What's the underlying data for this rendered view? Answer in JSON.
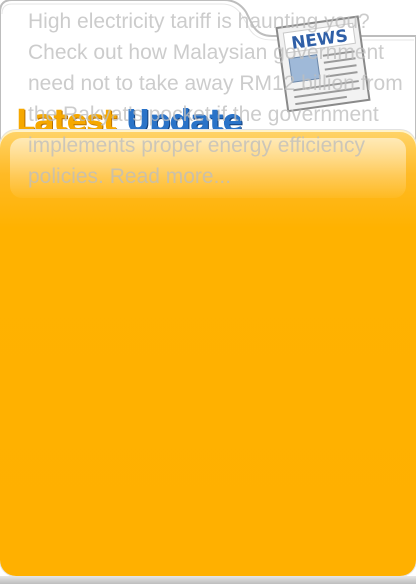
{
  "widget": {
    "headline_word1": "Latest",
    "headline_word2": "Update",
    "news_icon_label": "NEWS"
  },
  "article": {
    "text": "High electricity tariff is haunting you? Check out how Malaysian government need not to take away RM12 billion from the Rakyat's pocket if the government implements proper energy efficiency policies.",
    "read_more": "Read more..."
  },
  "colors": {
    "panel": "#ffb000",
    "headline_orange": "#f6a800",
    "headline_blue": "#2a73c8",
    "text_overlay": "#bebebe"
  }
}
